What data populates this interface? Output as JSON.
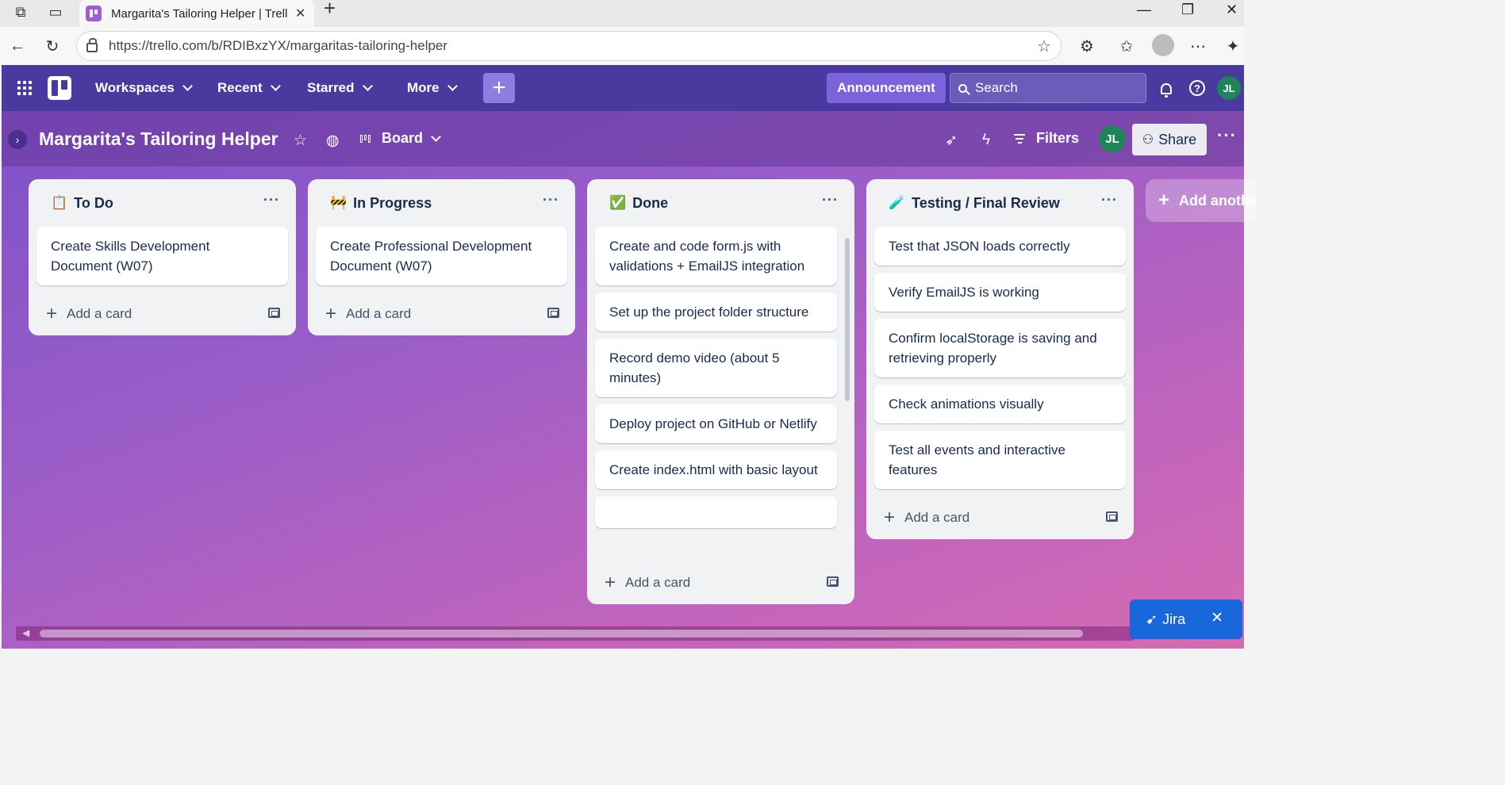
{
  "browser": {
    "tab_title": "Margarita's Tailoring Helper | Trello",
    "new_tab": "+",
    "url": "https://trello.com/b/RDIBxzYX/margaritas-tailoring-helper"
  },
  "header": {
    "workspaces": "Workspaces",
    "recent": "Recent",
    "starred": "Starred",
    "more": "More",
    "create": "+",
    "announcement": "Announcement",
    "search_placeholder": "Search",
    "user_initials": "JL"
  },
  "board": {
    "title": "Margarita's Tailoring Helper",
    "view": "Board",
    "filters": "Filters",
    "member_initials": "JL",
    "share": "Share"
  },
  "lists": [
    {
      "emoji": "📋",
      "title": "To Do",
      "cards": [
        "Create Skills Development Document (W07)"
      ],
      "add_card": "Add a card"
    },
    {
      "emoji": "🚧",
      "title": "In Progress",
      "cards": [
        "Create Professional Development Document (W07)"
      ],
      "add_card": "Add a card"
    },
    {
      "emoji": "✅",
      "title": "Done",
      "cards": [
        "Create and code form.js with validations + EmailJS integration",
        "Set up the project folder structure",
        "Record demo video (about 5 minutes)",
        "Deploy project on GitHub or Netlify",
        "Create index.html with basic layout"
      ],
      "add_card": "Add a card"
    },
    {
      "emoji": "🧪",
      "title": "Testing / Final Review",
      "cards": [
        "Test that JSON loads correctly",
        "Verify EmailJS is working",
        "Confirm localStorage is saving and retrieving properly",
        "Check animations visually",
        "Test all events and interactive features"
      ],
      "add_card": "Add a card"
    }
  ],
  "add_list": "Add another list",
  "jira": {
    "label": "Jira",
    "close": "✕"
  }
}
